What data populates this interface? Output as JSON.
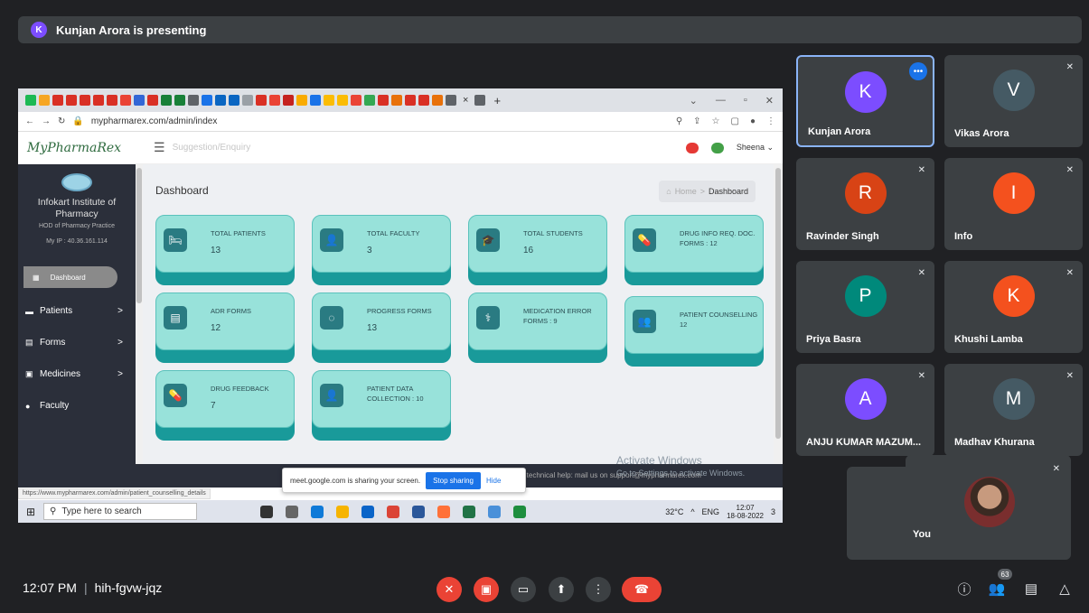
{
  "presenting": {
    "initial": "K",
    "text": "Kunjan Arora is presenting"
  },
  "browser": {
    "url": "mypharmarex.com/admin/index",
    "status_url": "https://www.mypharmarex.com/admin/patient_counselling_details",
    "tab_close": "×",
    "new_tab": "+"
  },
  "app": {
    "logo": "MyPharmaRex",
    "menu_link": "Suggestion/Enquiry",
    "user": "Sheena",
    "institute": "Infokart Institute of Pharmacy",
    "role": "HOD of Pharmacy Practice",
    "ip": "My IP : 40.36.161.114",
    "dashboard_btn": "Dashboard",
    "nav": [
      {
        "label": "Patients",
        "icon": "bed-icon",
        "chev": ">"
      },
      {
        "label": "Forms",
        "icon": "forms-icon",
        "chev": ">"
      },
      {
        "label": "Medicines",
        "icon": "medicine-icon",
        "chev": ">"
      },
      {
        "label": "Faculty",
        "icon": "faculty-icon",
        "chev": ""
      }
    ],
    "page_title": "Dashboard",
    "crumb_home": "Home",
    "crumb_sep": ">",
    "crumb_current": "Dashboard",
    "cards": [
      {
        "label": "TOTAL PATIENTS",
        "value": "13",
        "icon": "bed-icon",
        "glyph": "🛏"
      },
      {
        "label": "TOTAL FACULTY",
        "value": "3",
        "icon": "faculty-icon",
        "glyph": "👤"
      },
      {
        "label": "TOTAL STUDENTS",
        "value": "16",
        "icon": "student-icon",
        "glyph": "🎓"
      },
      {
        "label": "DRUG INFO REQ. DOC. FORMS : 12",
        "value": "",
        "icon": "pill-icon",
        "glyph": "💊"
      },
      {
        "label": "ADR FORMS",
        "value": "12",
        "icon": "form-icon",
        "glyph": "▤"
      },
      {
        "label": "PROGRESS FORMS",
        "value": "13",
        "icon": "progress-icon",
        "glyph": "◌"
      },
      {
        "label": "MEDICATION ERROR FORMS : 9",
        "value": "",
        "icon": "stethoscope-icon",
        "glyph": "⚕"
      },
      {
        "label": "PATIENT COUNSELLING 12",
        "value": "",
        "icon": "group-icon",
        "glyph": "👥"
      },
      {
        "label": "DRUG FEEDBACK",
        "value": "7",
        "icon": "pill-icon",
        "glyph": "💊"
      },
      {
        "label": "PATIENT DATA COLLECTION : 10",
        "value": "",
        "icon": "user-icon",
        "glyph": "👤"
      }
    ],
    "footer_help": "ny technical help: mail us on support@mypharmarex.com",
    "activate_title": "Activate Windows",
    "activate_sub": "Go to Settings to activate Windows."
  },
  "sharebar": {
    "text": "meet.google.com is sharing your screen.",
    "stop": "Stop sharing",
    "hide": "Hide"
  },
  "taskbar": {
    "search": "Type here to search",
    "temp": "32°C",
    "lang": "ENG",
    "time": "12:07",
    "date": "18-08-2022",
    "notif": "3"
  },
  "participants": [
    {
      "initial": "K",
      "name": "Kunjan Arora",
      "color": "#7c4dff"
    },
    {
      "initial": "V",
      "name": "Vikas Arora",
      "color": "#455a64"
    },
    {
      "initial": "R",
      "name": "Ravinder Singh",
      "color": "#d84315"
    },
    {
      "initial": "I",
      "name": "Info",
      "color": "#f4511e"
    },
    {
      "initial": "P",
      "name": "Priya Basra",
      "color": "#00897b"
    },
    {
      "initial": "K",
      "name": "Khushi Lamba",
      "color": "#f4511e"
    },
    {
      "initial": "A",
      "name": "ANJU KUMAR MAZUM...",
      "color": "#7c4dff"
    },
    {
      "initial": "M",
      "name": "Madhav Khurana",
      "color": "#455a64"
    }
  ],
  "you": {
    "name": "You"
  },
  "meeting": {
    "time": "12:07 PM",
    "sep": "|",
    "code": "hih-fgvw-jqz",
    "people_count": "63"
  },
  "colors": {
    "end_call": "#ea4335",
    "muted": "#ea4335",
    "control": "#3c4043",
    "accent": "#1a73e8"
  }
}
